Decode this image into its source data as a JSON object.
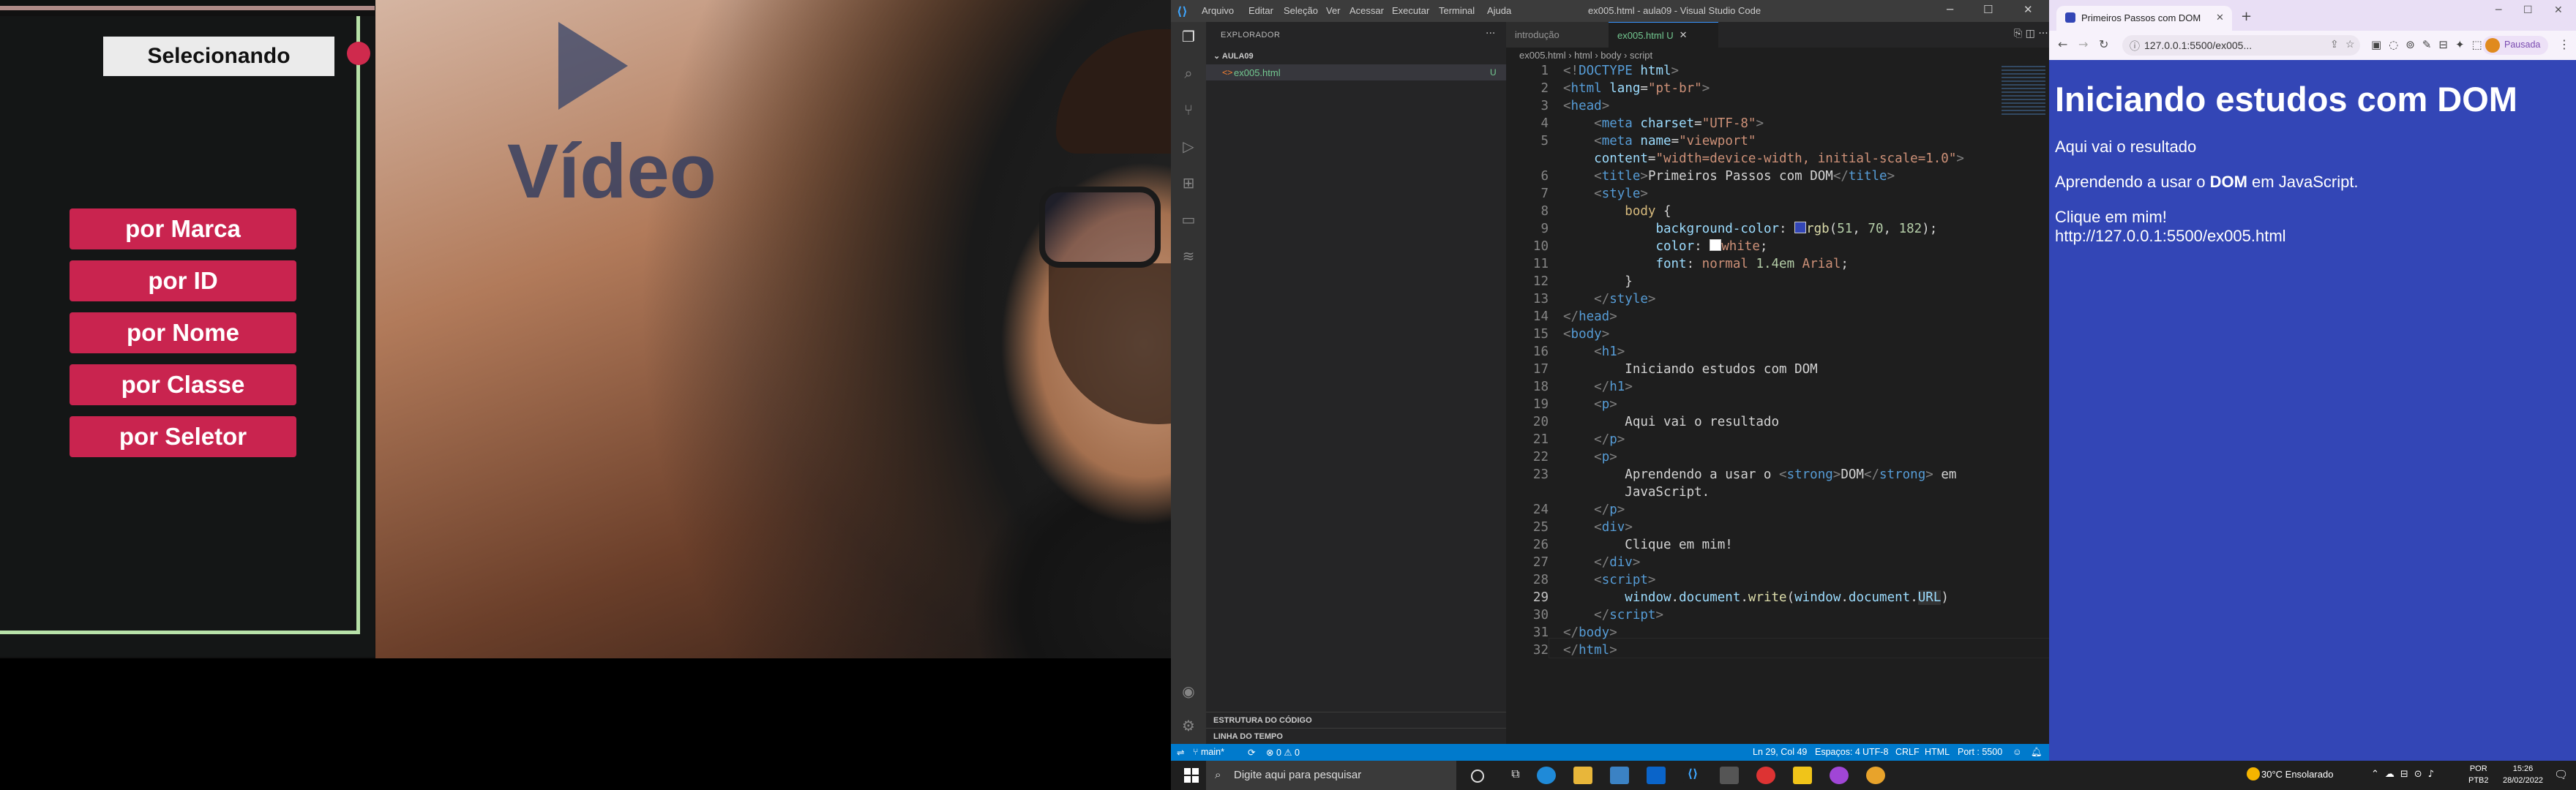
{
  "video_overlay": {
    "title": "Selecionando",
    "buttons": [
      "por Marca",
      "por ID",
      "por Nome",
      "por Classe",
      "por Seletor"
    ],
    "photo_watermark": "Vídeo",
    "accent_color": "#c9244f"
  },
  "vscode": {
    "menu": [
      "Arquivo",
      "Editar",
      "Seleção",
      "Ver",
      "Acessar",
      "Executar",
      "Terminal",
      "Ajuda"
    ],
    "window_title": "ex005.html - aula09 - Visual Studio Code",
    "sidebar": {
      "title": "EXPLORADOR",
      "folder": "AULA09",
      "file": "ex005.html",
      "file_badge": "U",
      "sections": [
        "ESTRUTURA DO CÓDIGO",
        "LINHA DO TEMPO"
      ]
    },
    "tabs": [
      {
        "label": "introdução"
      },
      {
        "label": "ex005.html U"
      }
    ],
    "breadcrumb": "ex005.html › html › body › script",
    "code_lines": [
      {
        "n": "1"
      },
      {
        "n": "2"
      },
      {
        "n": "3"
      },
      {
        "n": "4"
      },
      {
        "n": "5"
      },
      {
        "n": ""
      },
      {
        "n": "6"
      },
      {
        "n": "7"
      },
      {
        "n": "8"
      },
      {
        "n": "9"
      },
      {
        "n": "10"
      },
      {
        "n": "11"
      },
      {
        "n": "12"
      },
      {
        "n": "13"
      },
      {
        "n": "14"
      },
      {
        "n": "15"
      },
      {
        "n": "16"
      },
      {
        "n": "17"
      },
      {
        "n": "18"
      },
      {
        "n": "19"
      },
      {
        "n": "20"
      },
      {
        "n": "21"
      },
      {
        "n": "22"
      },
      {
        "n": "23"
      },
      {
        "n": ""
      },
      {
        "n": "24"
      },
      {
        "n": "25"
      },
      {
        "n": "26"
      },
      {
        "n": "27"
      },
      {
        "n": "28"
      },
      {
        "n": "29"
      },
      {
        "n": "30"
      },
      {
        "n": "31"
      },
      {
        "n": "32"
      }
    ],
    "status": {
      "branch": "main*",
      "problems": "⊗ 0 ⚠ 0",
      "position": "Ln 29, Col 49",
      "spaces": "Espaços: 4",
      "encoding": "UTF-8",
      "eol": "CRLF",
      "language": "HTML",
      "port": "Port : 5500"
    }
  },
  "chrome": {
    "tab_title": "Primeiros Passos com DOM",
    "url": "127.0.0.1:5500/ex005...",
    "profile": "Pausada",
    "page": {
      "h1": "Iniciando estudos com DOM",
      "p1": "Aqui vai o resultado",
      "p2_before": "Aprendendo a usar o ",
      "p2_strong": "DOM",
      "p2_after": " em JavaScript.",
      "div": "Clique em mim!",
      "written_url": "http://127.0.0.1:5500/ex005.html"
    },
    "background_color": "#3346b6"
  },
  "taskbar": {
    "search_placeholder": "Digite aqui para pesquisar",
    "weather": "30°C  Ensolarado",
    "lang_top": "POR",
    "lang_bottom": "PTB2",
    "time": "15:26",
    "date": "28/02/2022"
  }
}
